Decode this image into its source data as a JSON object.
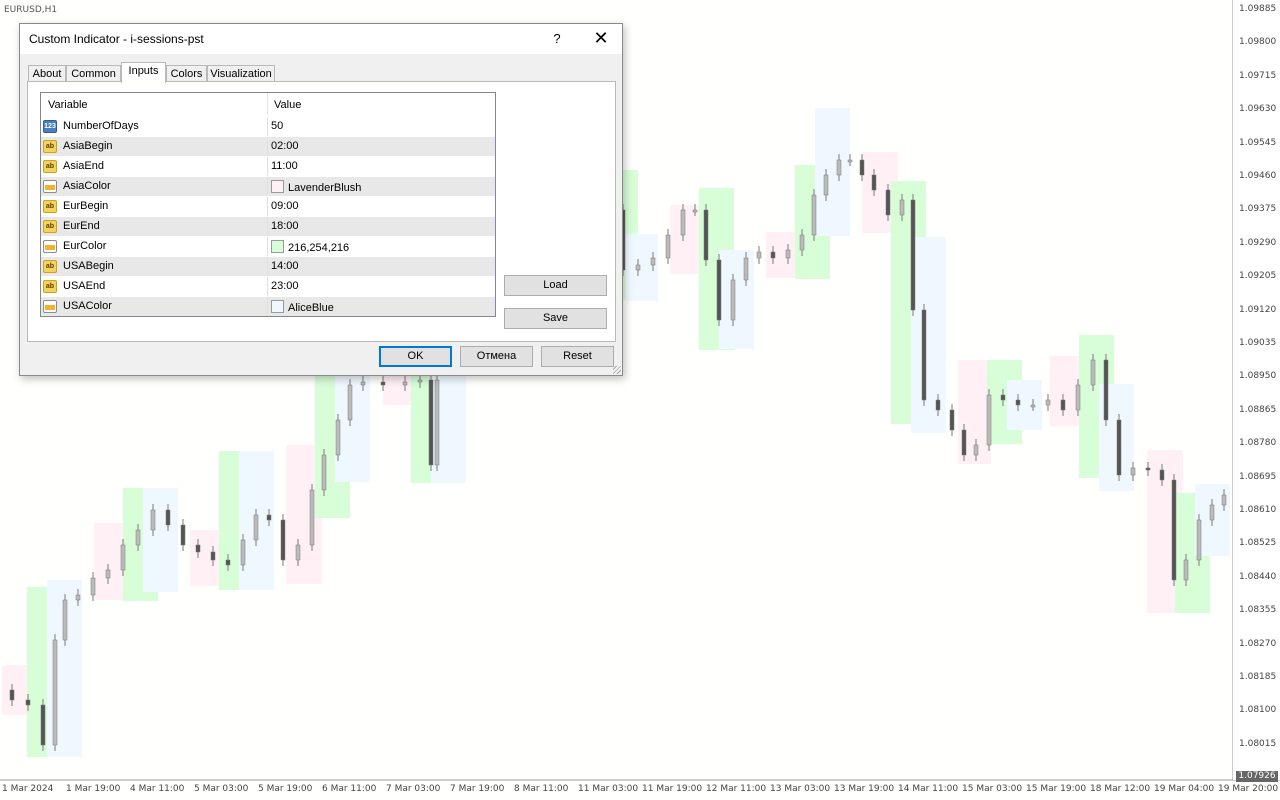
{
  "chart": {
    "symbol": "EURUSD,H1",
    "last_price": "1.07926",
    "price_labels": [
      "1.09885",
      "1.09800",
      "1.09715",
      "1.09630",
      "1.09545",
      "1.09460",
      "1.09375",
      "1.09290",
      "1.09205",
      "1.09120",
      "1.09035",
      "1.08950",
      "1.08865",
      "1.08780",
      "1.08695",
      "1.08610",
      "1.08525",
      "1.08440",
      "1.08355",
      "1.08270",
      "1.08185",
      "1.08100",
      "1.08015"
    ],
    "time_labels": [
      "1 Mar 2024",
      "1 Mar 19:00",
      "4 Mar 11:00",
      "5 Mar 03:00",
      "5 Mar 19:00",
      "6 Mar 11:00",
      "7 Mar 03:00",
      "7 Mar 19:00",
      "8 Mar 11:00",
      "11 Mar 03:00",
      "11 Mar 19:00",
      "12 Mar 11:00",
      "13 Mar 03:00",
      "13 Mar 19:00",
      "14 Mar 11:00",
      "15 Mar 03:00",
      "15 Mar 19:00",
      "18 Mar 12:00",
      "19 Mar 04:00",
      "19 Mar 20:00"
    ],
    "session_colors": {
      "asia": "#FFF0F5",
      "eur": "#D8FED8",
      "usa": "#F0F8FF"
    }
  },
  "dialog": {
    "title": "Custom Indicator - i-sessions-pst",
    "help_label": "?",
    "close_label": "✕",
    "tabs": [
      {
        "label": "About"
      },
      {
        "label": "Common"
      },
      {
        "label": "Inputs"
      },
      {
        "label": "Colors"
      },
      {
        "label": "Visualization"
      }
    ],
    "active_tab": "Inputs",
    "grid": {
      "col_variable": "Variable",
      "col_value": "Value",
      "rows": [
        {
          "icon": "number-icon",
          "name": "NumberOfDays",
          "value": "50"
        },
        {
          "icon": "string-icon",
          "name": "AsiaBegin",
          "value": "02:00"
        },
        {
          "icon": "string-icon",
          "name": "AsiaEnd",
          "value": "11:00"
        },
        {
          "icon": "color-icon",
          "name": "AsiaColor",
          "value": "LavenderBlush",
          "swatch": "#FFF0F5"
        },
        {
          "icon": "string-icon",
          "name": "EurBegin",
          "value": "09:00"
        },
        {
          "icon": "string-icon",
          "name": "EurEnd",
          "value": "18:00"
        },
        {
          "icon": "color-icon",
          "name": "EurColor",
          "value": "216,254,216",
          "swatch": "#D8FED8"
        },
        {
          "icon": "string-icon",
          "name": "USABegin",
          "value": "14:00"
        },
        {
          "icon": "string-icon",
          "name": "USAEnd",
          "value": "23:00"
        },
        {
          "icon": "color-icon",
          "name": "USAColor",
          "value": "AliceBlue",
          "swatch": "#F0F8FF"
        }
      ]
    },
    "buttons": {
      "load": "Load",
      "save": "Save",
      "ok": "OK",
      "cancel": "Отмена",
      "reset": "Reset"
    }
  }
}
